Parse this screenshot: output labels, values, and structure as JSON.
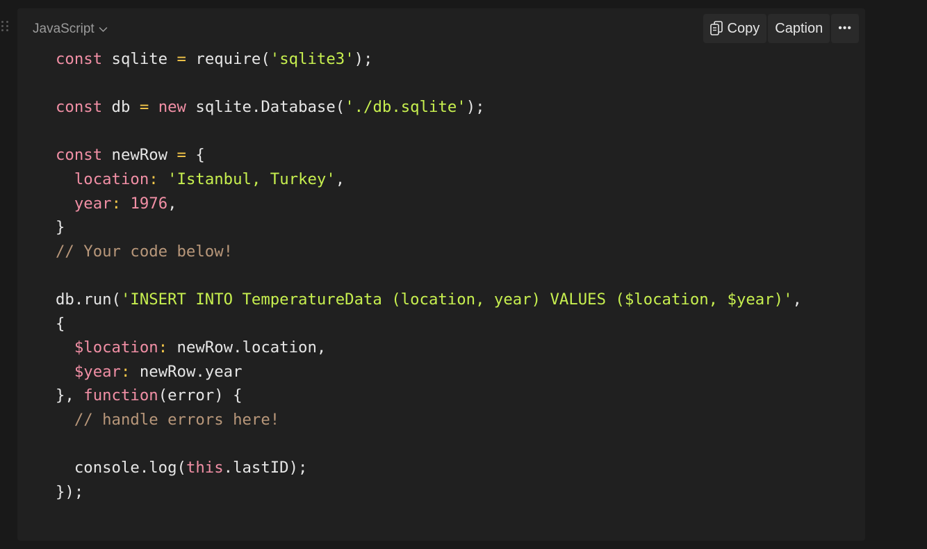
{
  "block": {
    "language": "JavaScript",
    "actions": {
      "copy": "Copy",
      "caption": "Caption",
      "more": "•••"
    }
  },
  "code_lines": [
    [
      [
        "k",
        "const"
      ],
      [
        "p",
        " sqlite "
      ],
      [
        "o",
        "="
      ],
      [
        "p",
        " require("
      ],
      [
        "s",
        "'sqlite3'"
      ],
      [
        "p",
        ");"
      ]
    ],
    [],
    [
      [
        "k",
        "const"
      ],
      [
        "p",
        " db "
      ],
      [
        "o",
        "="
      ],
      [
        "p",
        " "
      ],
      [
        "k",
        "new"
      ],
      [
        "p",
        " sqlite.Database("
      ],
      [
        "s",
        "'./db.sqlite'"
      ],
      [
        "p",
        ");"
      ]
    ],
    [],
    [
      [
        "k",
        "const"
      ],
      [
        "p",
        " newRow "
      ],
      [
        "o",
        "="
      ],
      [
        "p",
        " {"
      ]
    ],
    [
      [
        "p",
        "  "
      ],
      [
        "r",
        "location"
      ],
      [
        "c",
        ":"
      ],
      [
        "p",
        " "
      ],
      [
        "s",
        "'Istanbul, Turkey'"
      ],
      [
        "p",
        ","
      ]
    ],
    [
      [
        "p",
        "  "
      ],
      [
        "r",
        "year"
      ],
      [
        "c",
        ":"
      ],
      [
        "p",
        " "
      ],
      [
        "n",
        "1976"
      ],
      [
        "p",
        ","
      ]
    ],
    [
      [
        "p",
        "}"
      ]
    ],
    [
      [
        "m",
        "// Your code below!"
      ]
    ],
    [],
    [
      [
        "p",
        "db.run("
      ],
      [
        "s",
        "'INSERT INTO TemperatureData (location, year) VALUES ($location, $year)'"
      ],
      [
        "p",
        ","
      ]
    ],
    [
      [
        "p",
        "{"
      ]
    ],
    [
      [
        "p",
        "  "
      ],
      [
        "r",
        "$location"
      ],
      [
        "c",
        ":"
      ],
      [
        "p",
        " newRow.location,"
      ]
    ],
    [
      [
        "p",
        "  "
      ],
      [
        "r",
        "$year"
      ],
      [
        "c",
        ":"
      ],
      [
        "p",
        " newRow.year"
      ]
    ],
    [
      [
        "p",
        "}, "
      ],
      [
        "k",
        "function"
      ],
      [
        "p",
        "(error) {"
      ]
    ],
    [
      [
        "p",
        "  "
      ],
      [
        "m",
        "// handle errors here!"
      ]
    ],
    [],
    [
      [
        "p",
        "  console.log("
      ],
      [
        "k",
        "this"
      ],
      [
        "p",
        ".lastID);"
      ]
    ],
    [
      [
        "p",
        "});"
      ]
    ]
  ],
  "token_classes": {
    "k": "kw",
    "o": "op",
    "s": "str",
    "n": "num",
    "r": "prop",
    "c": "colon",
    "m": "cm",
    "p": "pl"
  },
  "colors": {
    "background": "#191919",
    "block_background": "#202020",
    "keyword": "#f18fa5",
    "operator": "#f7c94a",
    "string": "#c7ef4f",
    "comment": "#b8977a",
    "text": "#e6e6e6"
  },
  "icons": {
    "drag_handle": "drag-handle-icon",
    "copy": "copy-icon",
    "language_dropdown": "chevron-down-icon"
  }
}
